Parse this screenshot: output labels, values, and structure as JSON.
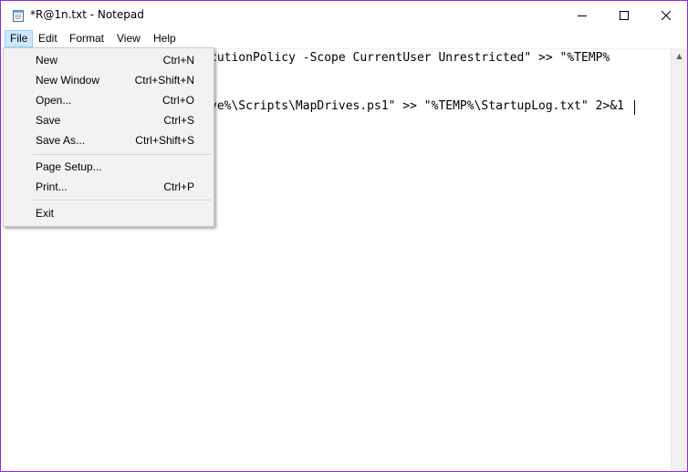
{
  "window": {
    "title": "*R@1n.txt - Notepad"
  },
  "menubar": {
    "items": [
      "File",
      "Edit",
      "Format",
      "View",
      "Help"
    ]
  },
  "editor": {
    "lines": [
      "cutionPolicy -Scope CurrentUser Unrestricted\" >> \"%TEMP%",
      "ve%\\Scripts\\MapDrives.ps1\" >> \"%TEMP%\\StartupLog.txt\" 2>&1"
    ]
  },
  "file_menu": {
    "items": [
      {
        "label": "New",
        "shortcut": "Ctrl+N"
      },
      {
        "label": "New Window",
        "shortcut": "Ctrl+Shift+N"
      },
      {
        "label": "Open...",
        "shortcut": "Ctrl+O"
      },
      {
        "label": "Save",
        "shortcut": "Ctrl+S"
      },
      {
        "label": "Save As...",
        "shortcut": "Ctrl+Shift+S"
      },
      {
        "label": "Page Setup...",
        "shortcut": ""
      },
      {
        "label": "Print...",
        "shortcut": "Ctrl+P"
      },
      {
        "label": "Exit",
        "shortcut": ""
      }
    ]
  },
  "colors": {
    "window_border": "#8a2be2",
    "menu_highlight": "#cce8ff",
    "menu_background": "#f2f2f2"
  }
}
